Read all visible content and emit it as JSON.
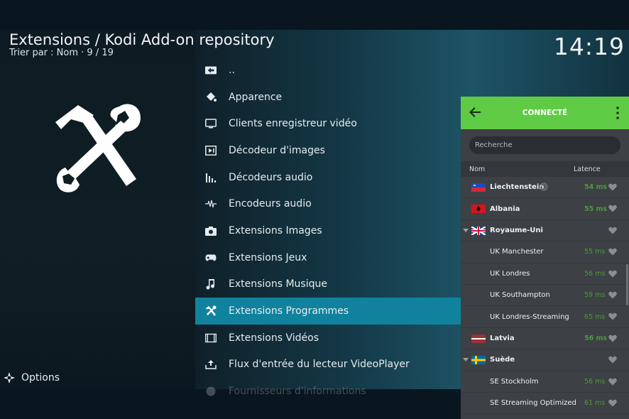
{
  "header": {
    "title": "Extensions / Kodi Add-on repository",
    "sort_info": "Trier par : Nom  ·  9 / 19",
    "clock": "14:19"
  },
  "sidebar": {
    "art_icon": "hammer-wrench-icon",
    "options_label": "Options"
  },
  "list": {
    "items": [
      {
        "label": "..",
        "icon": "parent-folder-icon"
      },
      {
        "label": "Apparence",
        "icon": "paint-bucket-icon"
      },
      {
        "label": "Clients enregistreur vidéo",
        "icon": "tv-icon"
      },
      {
        "label": "Décodeur d'images",
        "icon": "image-decoder-icon"
      },
      {
        "label": "Décodeurs audio",
        "icon": "audio-bars-icon"
      },
      {
        "label": "Encodeurs audio",
        "icon": "waveform-icon"
      },
      {
        "label": "Extensions Images",
        "icon": "camera-icon"
      },
      {
        "label": "Extensions Jeux",
        "icon": "gamepad-icon"
      },
      {
        "label": "Extensions Musique",
        "icon": "music-note-icon"
      },
      {
        "label": "Extensions Programmes",
        "icon": "tools-icon"
      },
      {
        "label": "Extensions Vidéos",
        "icon": "film-icon"
      },
      {
        "label": "Flux d'entrée du lecteur VideoPlayer",
        "icon": "upload-icon"
      },
      {
        "label": "Fournisseurs d'informations",
        "icon": "info-icon"
      }
    ],
    "selected_index": 9
  },
  "vpn": {
    "status": "CONNECTÉ",
    "search_placeholder": "Recherche",
    "col_name": "Nom",
    "col_latency": "Latence",
    "rows": [
      {
        "name": "Liechtenstein",
        "latency": "54 ms",
        "type": "country",
        "flag": "liechtenstein-flag",
        "fingerprint": true
      },
      {
        "name": "Albania",
        "latency": "55 ms",
        "type": "country",
        "flag": "albania-flag"
      },
      {
        "name": "Royaume-Uni",
        "latency": "",
        "type": "country",
        "flag": "uk-flag",
        "expanded": true
      },
      {
        "name": "UK Manchester",
        "latency": "55 ms",
        "type": "server"
      },
      {
        "name": "UK Londres",
        "latency": "56 ms",
        "type": "server"
      },
      {
        "name": "UK Southampton",
        "latency": "59 ms",
        "type": "server"
      },
      {
        "name": "UK Londres-Streaming",
        "latency": "65 ms",
        "type": "server"
      },
      {
        "name": "Latvia",
        "latency": "56 ms",
        "type": "country",
        "flag": "latvia-flag"
      },
      {
        "name": "Suède",
        "latency": "",
        "type": "country",
        "flag": "sweden-flag",
        "expanded": true
      },
      {
        "name": "SE Stockholm",
        "latency": "56 ms",
        "type": "server"
      },
      {
        "name": "SE Streaming Optimized",
        "latency": "61 ms",
        "type": "server"
      }
    ],
    "colors": {
      "header": "#5fcb45",
      "latency": "#4d9a3c"
    }
  },
  "colors": {
    "selection": "#11829e"
  }
}
